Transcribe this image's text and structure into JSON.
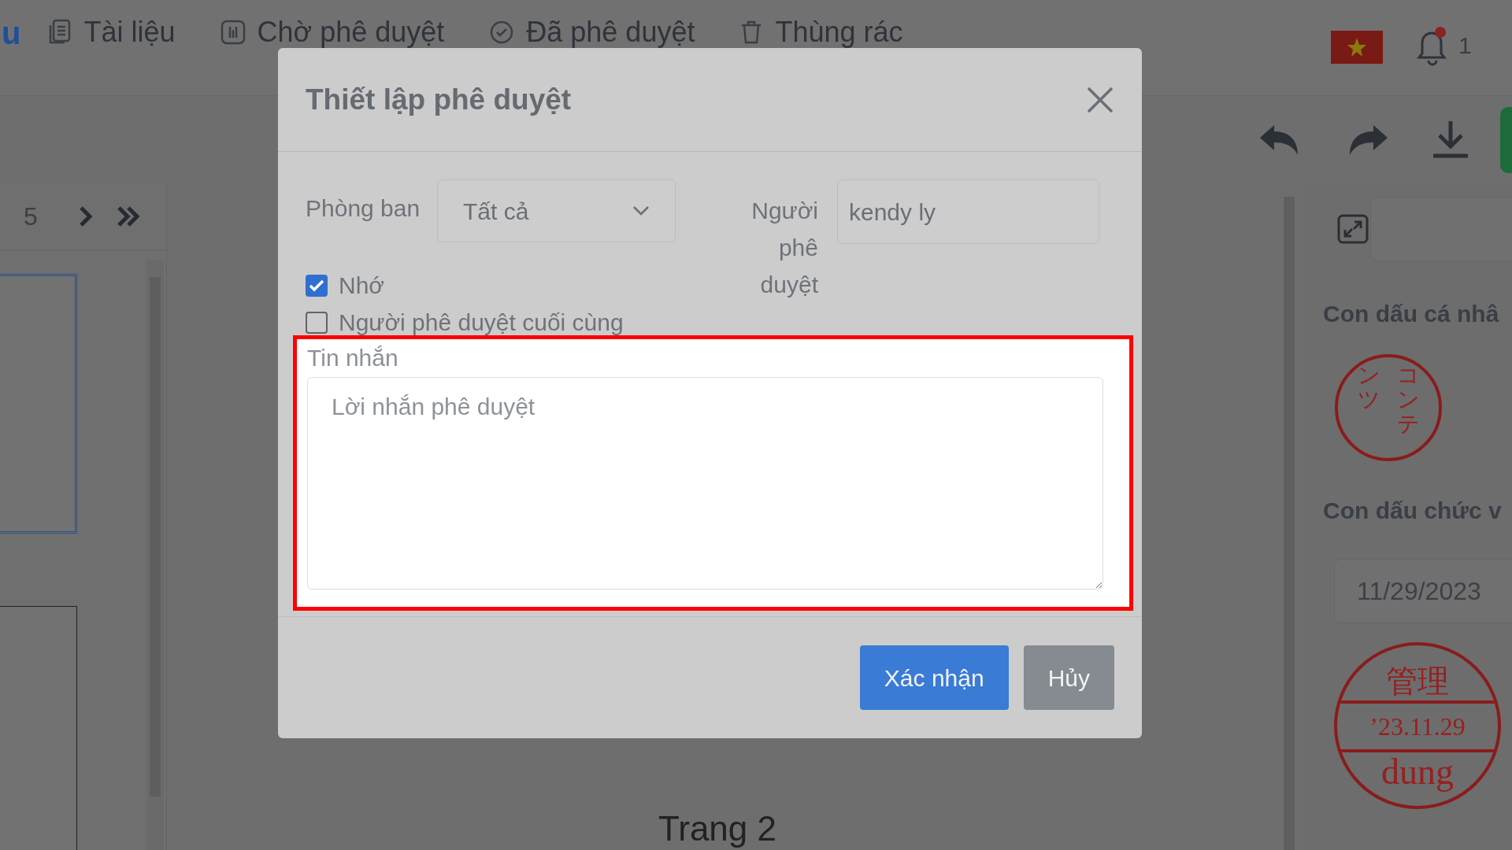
{
  "topbar": {
    "brand_fragment": "u",
    "nav": [
      {
        "label": "Tài liệu"
      },
      {
        "label": "Chờ phê duyệt"
      },
      {
        "label": "Đã phê duyệt"
      },
      {
        "label": "Thùng rác"
      }
    ],
    "notification_count": "1"
  },
  "pager": {
    "page": "5"
  },
  "document": {
    "page_label": "Trang 2"
  },
  "side_panel": {
    "personal_stamp_title": "Con dấu cá nhâ",
    "personal_stamp": {
      "columns": [
        "ンツ",
        "コンテ"
      ]
    },
    "position_stamp_title": "Con dấu chức v",
    "date": "11/29/2023",
    "position_stamp": {
      "top": "管理",
      "middle": "’23.11.29",
      "bottom": "dung"
    }
  },
  "dialog": {
    "title": "Thiết lập phê duyệt",
    "department": {
      "label": "Phòng ban",
      "value": "Tất cả"
    },
    "approver": {
      "label": "Người phê duyệt",
      "value": "kendy ly"
    },
    "options": [
      {
        "label": "Nhớ",
        "checked": true
      },
      {
        "label": "Người phê duyệt cuối cùng",
        "checked": false
      }
    ],
    "message": {
      "label": "Tin nhắn",
      "placeholder": "Lời nhắn phê duyệt",
      "highlighted": true
    },
    "buttons": [
      {
        "label": "Xác nhận",
        "kind": "primary"
      },
      {
        "label": "Hủy",
        "kind": "secondary"
      }
    ]
  }
}
